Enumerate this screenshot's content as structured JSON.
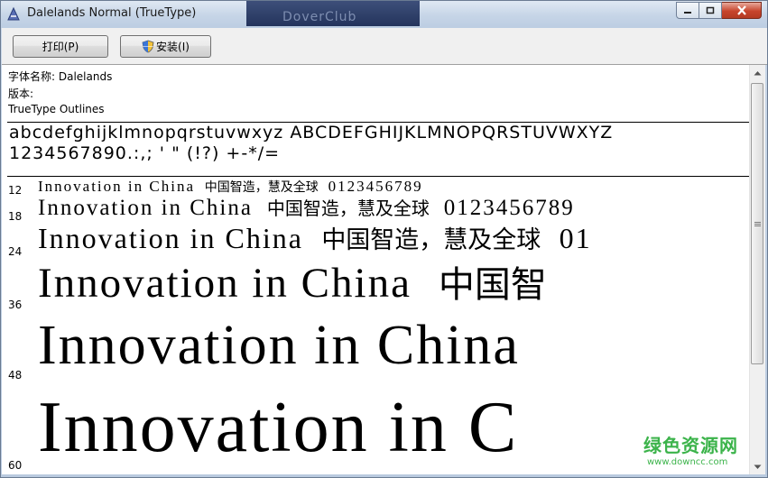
{
  "window": {
    "title": "Dalelands  Normal (TrueType)",
    "background_caption": "DoverClub"
  },
  "toolbar": {
    "print_label": "打印(P)",
    "install_label": "安装(I)"
  },
  "info": {
    "font_name": "字体名称: Dalelands",
    "version": "版本:",
    "type": "TrueType Outlines"
  },
  "samples": {
    "alphabet": "abcdefghijklmnopqrstuvwxyz  ABCDEFGHIJKLMNOPQRSTUVWXYZ",
    "digits": "1234567890.:,; ' \" (!?) +-*/="
  },
  "preview_rows": [
    {
      "size": "12",
      "latin": "Innovation in China",
      "cjk": "中国智造，慧及全球",
      "digits": "0123456789"
    },
    {
      "size": "18",
      "latin": "Innovation in China",
      "cjk": "中国智造，慧及全球",
      "digits": "0123456789"
    },
    {
      "size": "24",
      "latin": "Innovation in China",
      "cjk": "中国智造，慧及全球",
      "digits": "01"
    },
    {
      "size": "36",
      "latin": "Innovation in China",
      "cjk": "中国智",
      "digits": ""
    },
    {
      "size": "48",
      "latin": "Innovation in China",
      "cjk": "",
      "digits": ""
    },
    {
      "size": "60",
      "latin": "Innovation in C",
      "cjk": "",
      "digits": ""
    }
  ],
  "watermark": {
    "brand": "绿色资源网",
    "url": "www.downcc.com"
  },
  "colors": {
    "watermark": "#3bb34a",
    "close_button": "#c7442c"
  }
}
